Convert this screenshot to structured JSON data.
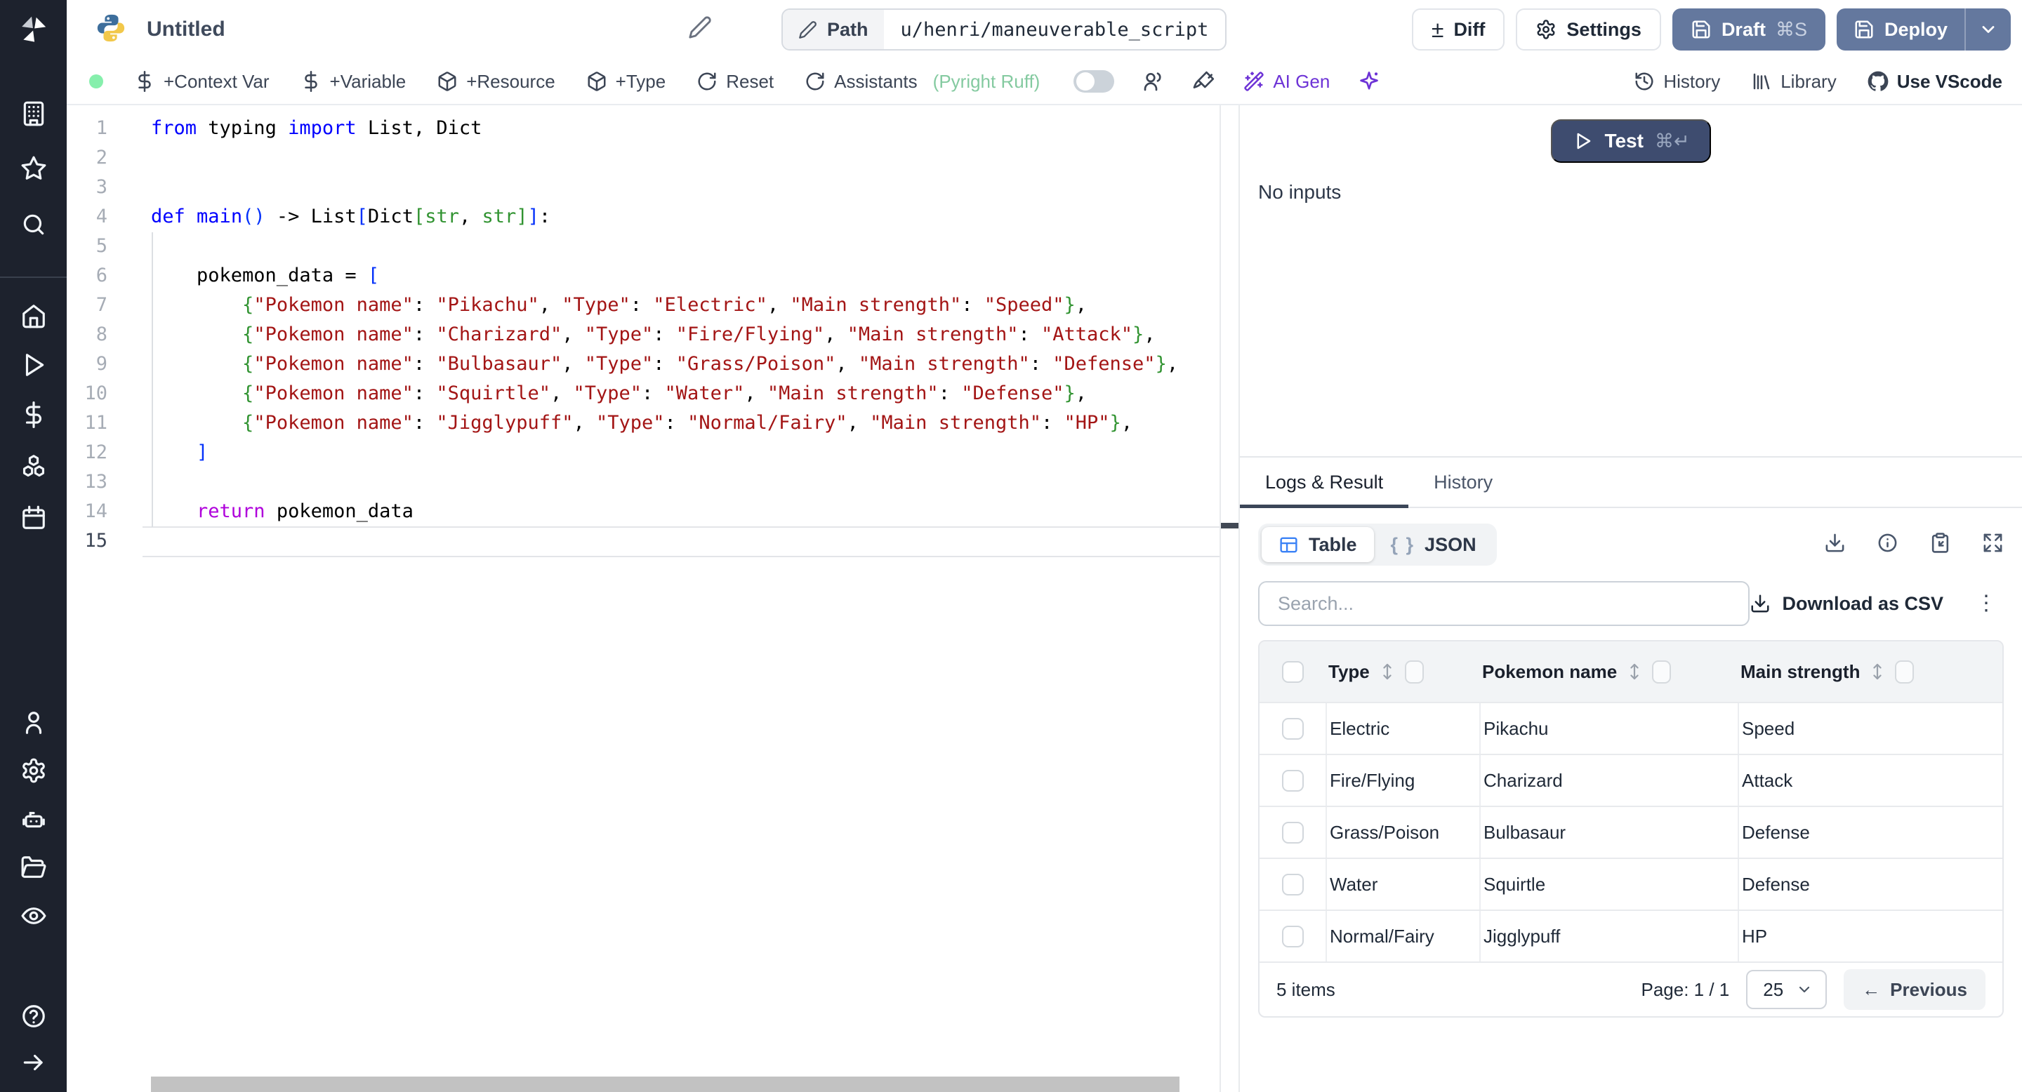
{
  "header": {
    "title": "Untitled",
    "path_label": "Path",
    "path_value": "u/henri/maneuverable_script",
    "diff": "Diff",
    "diff_glyph": "±",
    "settings": "Settings",
    "draft": "Draft",
    "draft_kbd": "⌘S",
    "deploy": "Deploy"
  },
  "toolbar": {
    "context_var": "+Context Var",
    "variable": "+Variable",
    "resource": "+Resource",
    "type": "+Type",
    "reset": "Reset",
    "assistants": "Assistants",
    "assistants_detail": "(Pyright Ruff)",
    "ai_gen": "AI Gen",
    "history": "History",
    "library": "Library",
    "use_vscode": "Use VScode"
  },
  "editor": {
    "active_line": 15,
    "lines": [
      {
        "n": 1,
        "t": [
          [
            "k",
            "from"
          ],
          [
            "p",
            " typing "
          ],
          [
            "k",
            "import"
          ],
          [
            "p",
            " List, Dict"
          ]
        ]
      },
      {
        "n": 2,
        "t": []
      },
      {
        "n": 3,
        "t": []
      },
      {
        "n": 4,
        "t": [
          [
            "k",
            "def"
          ],
          [
            "p",
            " "
          ],
          [
            "fn",
            "main"
          ],
          [
            "b1",
            "("
          ],
          [
            "b1",
            ")"
          ],
          [
            "p",
            " -> List"
          ],
          [
            "b1",
            "["
          ],
          [
            "p",
            "Dict"
          ],
          [
            "b2",
            "["
          ],
          [
            "t",
            "str"
          ],
          [
            "p",
            ", "
          ],
          [
            "t",
            "str"
          ],
          [
            "b2",
            "]"
          ],
          [
            "b1",
            "]"
          ],
          [
            "p",
            ":"
          ]
        ]
      },
      {
        "n": 5,
        "t": []
      },
      {
        "n": 6,
        "t": [
          [
            "p",
            "    pokemon_data = "
          ],
          [
            "b1",
            "["
          ]
        ]
      },
      {
        "n": 7,
        "t": [
          [
            "p",
            "        "
          ],
          [
            "b2",
            "{"
          ],
          [
            "s",
            "\"Pokemon name\""
          ],
          [
            "p",
            ": "
          ],
          [
            "s",
            "\"Pikachu\""
          ],
          [
            "p",
            ", "
          ],
          [
            "s",
            "\"Type\""
          ],
          [
            "p",
            ": "
          ],
          [
            "s",
            "\"Electric\""
          ],
          [
            "p",
            ", "
          ],
          [
            "s",
            "\"Main strength\""
          ],
          [
            "p",
            ": "
          ],
          [
            "s",
            "\"Speed\""
          ],
          [
            "b2",
            "}"
          ],
          [
            "p",
            ","
          ]
        ]
      },
      {
        "n": 8,
        "t": [
          [
            "p",
            "        "
          ],
          [
            "b2",
            "{"
          ],
          [
            "s",
            "\"Pokemon name\""
          ],
          [
            "p",
            ": "
          ],
          [
            "s",
            "\"Charizard\""
          ],
          [
            "p",
            ", "
          ],
          [
            "s",
            "\"Type\""
          ],
          [
            "p",
            ": "
          ],
          [
            "s",
            "\"Fire/Flying\""
          ],
          [
            "p",
            ", "
          ],
          [
            "s",
            "\"Main strength\""
          ],
          [
            "p",
            ": "
          ],
          [
            "s",
            "\"Attack\""
          ],
          [
            "b2",
            "}"
          ],
          [
            "p",
            ","
          ]
        ]
      },
      {
        "n": 9,
        "t": [
          [
            "p",
            "        "
          ],
          [
            "b2",
            "{"
          ],
          [
            "s",
            "\"Pokemon name\""
          ],
          [
            "p",
            ": "
          ],
          [
            "s",
            "\"Bulbasaur\""
          ],
          [
            "p",
            ", "
          ],
          [
            "s",
            "\"Type\""
          ],
          [
            "p",
            ": "
          ],
          [
            "s",
            "\"Grass/Poison\""
          ],
          [
            "p",
            ", "
          ],
          [
            "s",
            "\"Main strength\""
          ],
          [
            "p",
            ": "
          ],
          [
            "s",
            "\"Defense\""
          ],
          [
            "b2",
            "}"
          ],
          [
            "p",
            ","
          ]
        ]
      },
      {
        "n": 10,
        "t": [
          [
            "p",
            "        "
          ],
          [
            "b2",
            "{"
          ],
          [
            "s",
            "\"Pokemon name\""
          ],
          [
            "p",
            ": "
          ],
          [
            "s",
            "\"Squirtle\""
          ],
          [
            "p",
            ", "
          ],
          [
            "s",
            "\"Type\""
          ],
          [
            "p",
            ": "
          ],
          [
            "s",
            "\"Water\""
          ],
          [
            "p",
            ", "
          ],
          [
            "s",
            "\"Main strength\""
          ],
          [
            "p",
            ": "
          ],
          [
            "s",
            "\"Defense\""
          ],
          [
            "b2",
            "}"
          ],
          [
            "p",
            ","
          ]
        ]
      },
      {
        "n": 11,
        "t": [
          [
            "p",
            "        "
          ],
          [
            "b2",
            "{"
          ],
          [
            "s",
            "\"Pokemon name\""
          ],
          [
            "p",
            ": "
          ],
          [
            "s",
            "\"Jigglypuff\""
          ],
          [
            "p",
            ", "
          ],
          [
            "s",
            "\"Type\""
          ],
          [
            "p",
            ": "
          ],
          [
            "s",
            "\"Normal/Fairy\""
          ],
          [
            "p",
            ", "
          ],
          [
            "s",
            "\"Main strength\""
          ],
          [
            "p",
            ": "
          ],
          [
            "s",
            "\"HP\""
          ],
          [
            "b2",
            "}"
          ],
          [
            "p",
            ","
          ]
        ]
      },
      {
        "n": 12,
        "t": [
          [
            "p",
            "    "
          ],
          [
            "b1",
            "]"
          ]
        ]
      },
      {
        "n": 13,
        "t": []
      },
      {
        "n": 14,
        "t": [
          [
            "p",
            "    "
          ],
          [
            "c",
            "return"
          ],
          [
            "p",
            " pokemon_data"
          ]
        ]
      },
      {
        "n": 15,
        "t": []
      }
    ]
  },
  "runner": {
    "test": "Test",
    "test_kbd": "⌘↵",
    "no_inputs": "No inputs"
  },
  "results": {
    "tab_logs": "Logs & Result",
    "tab_history": "History",
    "view_table": "Table",
    "view_json": "JSON",
    "braces_glyph": "{ }",
    "kebab_glyph": "⋮",
    "search_placeholder": "Search...",
    "download_csv": "Download as CSV",
    "table": {
      "columns": [
        "Type",
        "Pokemon name",
        "Main strength"
      ],
      "rows": [
        [
          "Electric",
          "Pikachu",
          "Speed"
        ],
        [
          "Fire/Flying",
          "Charizard",
          "Attack"
        ],
        [
          "Grass/Poison",
          "Bulbasaur",
          "Defense"
        ],
        [
          "Water",
          "Squirtle",
          "Defense"
        ],
        [
          "Normal/Fairy",
          "Jigglypuff",
          "HP"
        ]
      ]
    },
    "footer": {
      "items": "5 items",
      "page": "Page: 1 / 1",
      "page_size": "25",
      "previous": "Previous",
      "prev_arrow": "←"
    }
  },
  "colors": {
    "accent_slate": "#64789e",
    "test_navy": "#3e4c6f",
    "status_green": "#86efac",
    "ai_purple": "#6d33d6",
    "table_icon_blue": "#3b82f6",
    "string_red": "#a31515",
    "keyword_blue": "#0000ff"
  }
}
